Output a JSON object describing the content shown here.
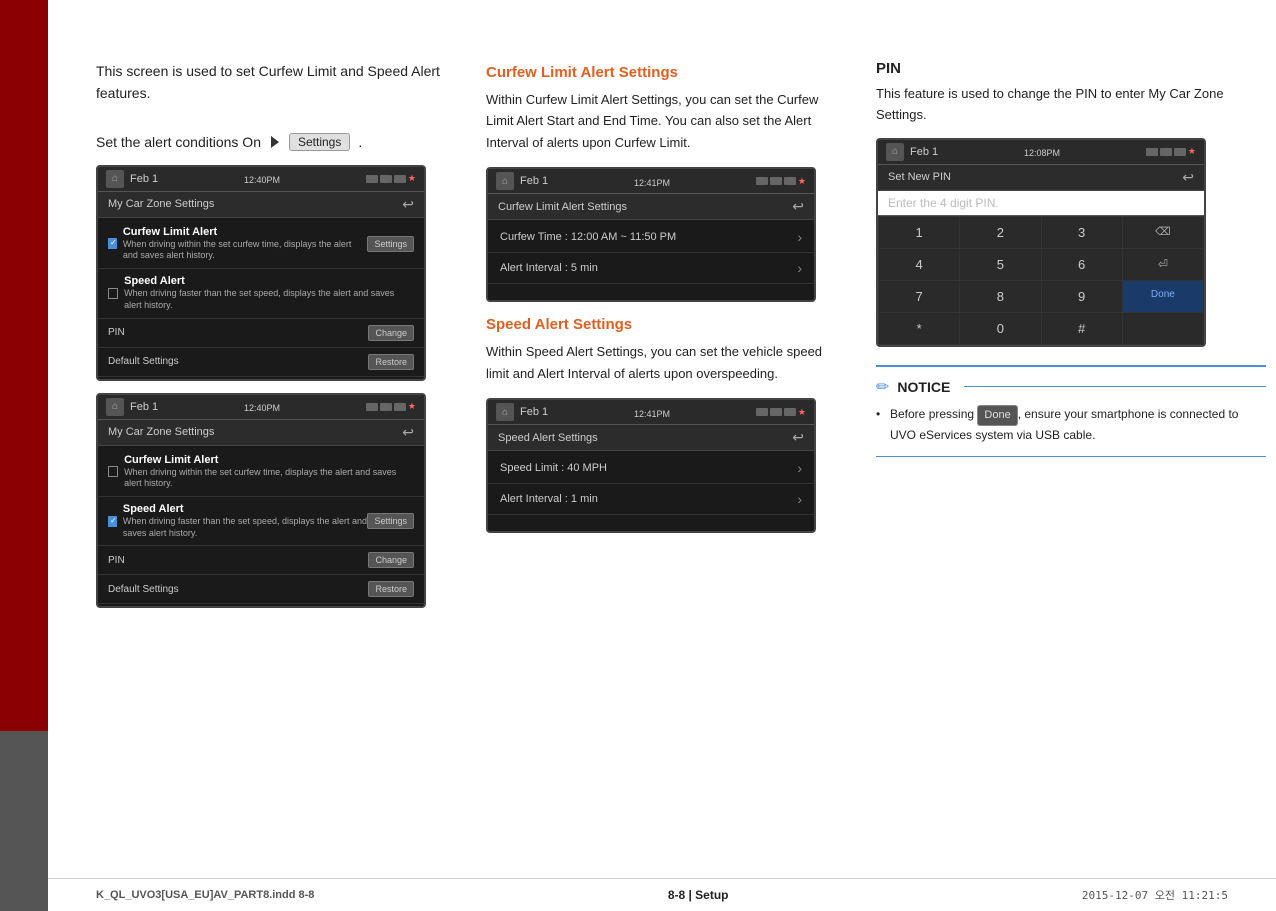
{
  "sidebar": {
    "color": "#8B0000"
  },
  "col_left": {
    "intro": "This screen is used to set Curfew Limit and Speed Alert features.",
    "alert_line": "Set the alert conditions On",
    "settings_label": "Settings",
    "screen1": {
      "time": "12:40",
      "time_suffix": "PM",
      "date": "Feb  1",
      "title": "My Car Zone Settings",
      "row1_label": "Curfew Limit Alert",
      "row1_sub": "When driving within the set curfew time, displays the alert and saves alert history.",
      "row1_btn": "Settings",
      "row2_label": "Speed Alert",
      "row2_sub": "When driving faster than the set speed, displays the alert and saves alert history.",
      "row3_label": "PIN",
      "row3_btn": "Change",
      "row4_label": "Default Settings",
      "row4_btn": "Restore"
    },
    "screen2": {
      "time": "12:40",
      "time_suffix": "PM",
      "date": "Feb  1",
      "title": "My Car Zone Settings",
      "row1_label": "Curfew Limit Alert",
      "row1_sub": "When driving within the set curfew time, displays the alert and saves alert history.",
      "row2_label": "Speed Alert",
      "row2_btn": "Settings",
      "row2_sub": "When driving faster than the set speed, displays the alert and saves alert history.",
      "row3_label": "PIN",
      "row3_btn": "Change",
      "row4_label": "Default Settings",
      "row4_btn": "Restore"
    }
  },
  "col_mid": {
    "curfew_title": "Curfew Limit Alert Settings",
    "curfew_body": "Within Curfew Limit Alert Settings, you can set the Curfew Limit Alert Start and End Time. You can also set the Alert Interval of alerts upon Curfew Limit.",
    "curfew_screen": {
      "time": "12:41",
      "time_suffix": "PM",
      "date": "Feb  1",
      "title": "Curfew Limit Alert Settings",
      "row1": "Curfew Time :  12:00 AM ~ 11:50 PM",
      "row2": "Alert Interval :  5 min"
    },
    "speed_title": "Speed Alert Settings",
    "speed_body": "Within Speed Alert Settings, you can set the vehicle speed limit and Alert Interval of alerts upon overspeeding.",
    "speed_screen": {
      "time": "12:41",
      "time_suffix": "PM",
      "date": "Feb  1",
      "title": "Speed Alert Settings",
      "row1": "Speed Limit :  40 MPH",
      "row2": "Alert Interval :  1 min"
    }
  },
  "col_right": {
    "pin_title": "PIN",
    "pin_body": "This feature is used to change the PIN to enter My Car Zone Settings.",
    "pin_screen": {
      "time": "12:08",
      "time_suffix": "PM",
      "date": "Feb  1",
      "title": "Set New PIN",
      "input_placeholder": "Enter the 4 digit PIN.",
      "keys": [
        "1",
        "2",
        "3",
        "⌫",
        "4",
        "5",
        "6",
        "⏎",
        "7",
        "8",
        "9",
        "Done",
        "*",
        "0",
        "#",
        ""
      ]
    },
    "notice_title": "NOTICE",
    "notice_items": [
      "Before pressing Done , ensure your smartphone is connected to UVO eServices system via USB cable."
    ]
  },
  "footer": {
    "left": "K_QL_UVO3[USA_EU]AV_PART8.indd   8-8",
    "page": "8-8 | Setup",
    "right": "2015-12-07   오전 11:21:5"
  }
}
